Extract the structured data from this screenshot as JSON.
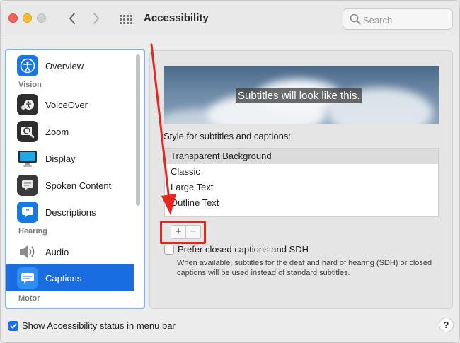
{
  "window": {
    "title": "Accessibility"
  },
  "search": {
    "placeholder": "Search"
  },
  "sidebar": {
    "items": [
      {
        "label": "Overview"
      },
      {
        "label": "VoiceOver"
      },
      {
        "label": "Zoom"
      },
      {
        "label": "Display"
      },
      {
        "label": "Spoken Content"
      },
      {
        "label": "Descriptions"
      },
      {
        "label": "Audio"
      },
      {
        "label": "Captions",
        "selected": true
      }
    ],
    "sections": {
      "vision": "Vision",
      "hearing": "Hearing",
      "motor": "Motor"
    }
  },
  "captions": {
    "preview_text": "Subtitles will look like this.",
    "style_label": "Style for subtitles and captions:",
    "styles": [
      "Transparent Background",
      "Classic",
      "Large Text",
      "Outline Text"
    ],
    "selected_style": "Transparent Background",
    "add_label": "+",
    "remove_label": "−",
    "prefer_cc_label": "Prefer closed captions and SDH",
    "prefer_cc_checked": false,
    "prefer_cc_help": "When available, subtitles for the deaf and hard of hearing (SDH) or closed captions will be used instead of standard subtitles."
  },
  "footer": {
    "show_status_label": "Show Accessibility status in menu bar",
    "show_status_checked": true,
    "help_label": "?"
  },
  "colors": {
    "accent": "#1a6de0",
    "annotation_red": "#e8261e"
  }
}
